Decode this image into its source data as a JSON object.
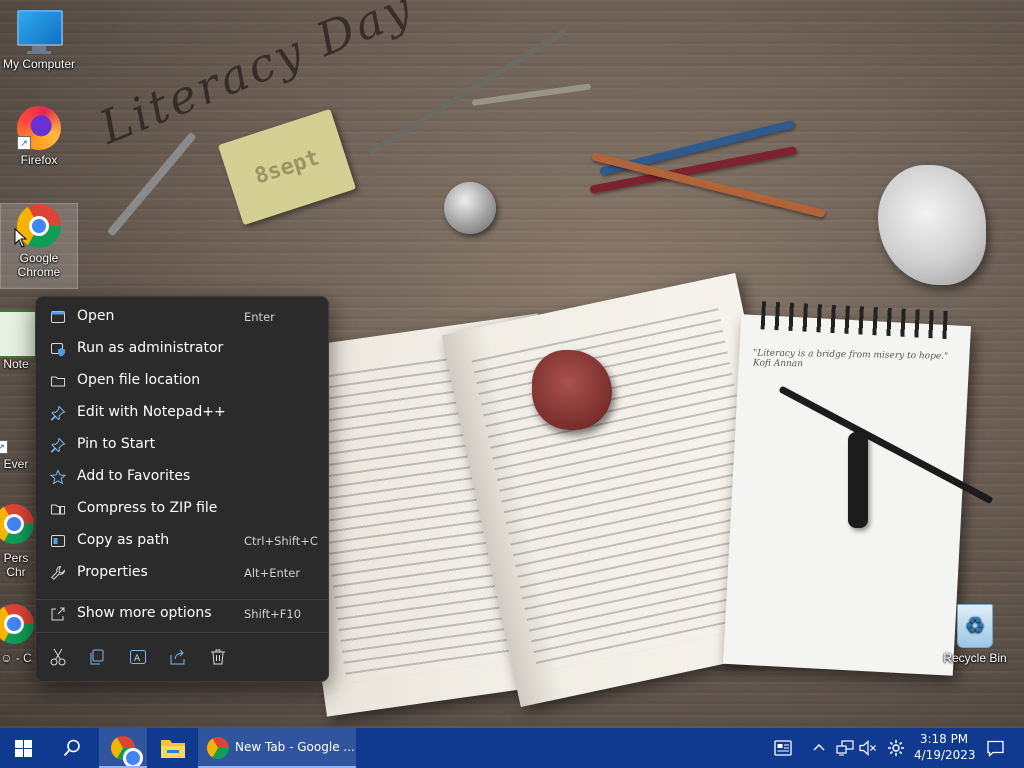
{
  "desktop": {
    "icons": [
      {
        "label": "My Computer"
      },
      {
        "label": "Firefox"
      },
      {
        "label": "Google Chrome"
      },
      {
        "label": "Note"
      },
      {
        "label": "Ever"
      },
      {
        "label": "Pers\nChr"
      },
      {
        "label": "☺ - C"
      },
      {
        "label": "Recycle Bin"
      }
    ],
    "wallpaper": {
      "title": "Literacy Day",
      "tag": "8sept",
      "quote": "\"Literacy is a bridge from misery to hope.\" Kofi Annan"
    }
  },
  "context_menu": {
    "items": [
      {
        "label": "Open",
        "shortcut": "Enter",
        "icon": "window-icon"
      },
      {
        "label": "Run as administrator",
        "shortcut": "",
        "icon": "shield-icon"
      },
      {
        "label": "Open file location",
        "shortcut": "",
        "icon": "folder-icon"
      },
      {
        "label": "Edit with Notepad++",
        "shortcut": "",
        "icon": "pin-icon"
      },
      {
        "label": "Pin to Start",
        "shortcut": "",
        "icon": "pin-icon"
      },
      {
        "label": "Add to Favorites",
        "shortcut": "",
        "icon": "star-icon"
      },
      {
        "label": "Compress to ZIP file",
        "shortcut": "",
        "icon": "zip-icon"
      },
      {
        "label": "Copy as path",
        "shortcut": "Ctrl+Shift+C",
        "icon": "path-icon"
      },
      {
        "label": "Properties",
        "shortcut": "Alt+Enter",
        "icon": "wrench-icon"
      },
      {
        "label": "Show more options",
        "shortcut": "Shift+F10",
        "icon": "share-icon"
      }
    ],
    "quick_actions": [
      "cut-icon",
      "copy-icon",
      "rename-icon",
      "share-icon",
      "delete-icon"
    ]
  },
  "taskbar": {
    "active_tab_label": "New Tab - Google ...",
    "clock": {
      "time": "3:18 PM",
      "date": "4/19/2023"
    },
    "accent": "#0f3a8f"
  }
}
